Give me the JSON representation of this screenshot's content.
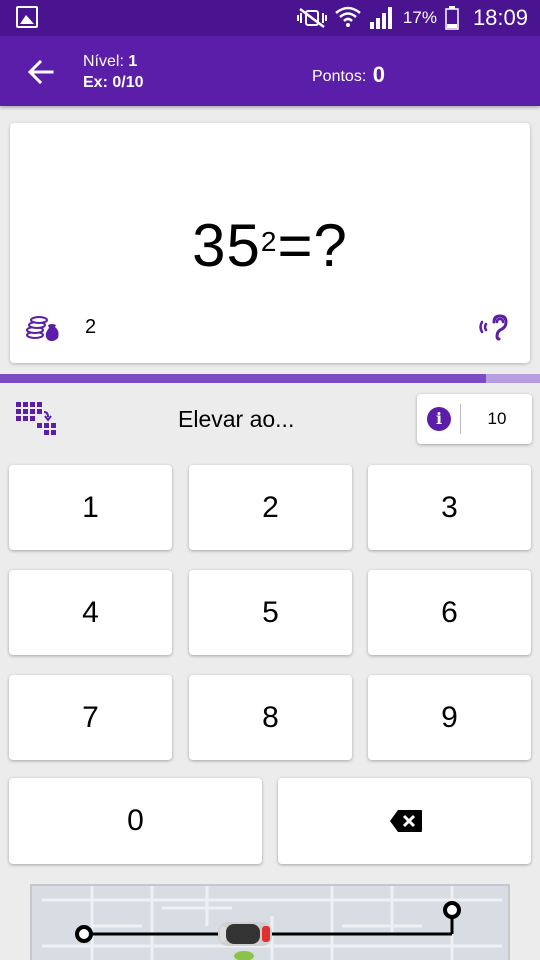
{
  "status_bar": {
    "battery_percent": "17%",
    "time": "18:09",
    "icons": [
      "gallery-icon",
      "mute-vibrate-icon",
      "wifi-icon",
      "signal-icon",
      "battery-icon"
    ]
  },
  "header": {
    "level_label": "Nível:",
    "level_value": "1",
    "exercise_label": "Ex:",
    "exercise_value": "0/10",
    "points_label": "Pontos:",
    "points_value": "0"
  },
  "question": {
    "base": "35",
    "exponent": "2",
    "suffix": "=?",
    "coins_count": "2"
  },
  "progress": {
    "fraction": 0.9
  },
  "task": {
    "hint": "Elevar ao...",
    "info_value": "10"
  },
  "keypad": {
    "keys": [
      "1",
      "2",
      "3",
      "4",
      "5",
      "6",
      "7",
      "8",
      "9",
      "0"
    ]
  },
  "colors": {
    "statusbar": "#4a1490",
    "appbar": "#5a1ea8",
    "accent": "#5a1ea8",
    "progress_fill": "#7c4cc4",
    "progress_track": "#b79ee0"
  }
}
